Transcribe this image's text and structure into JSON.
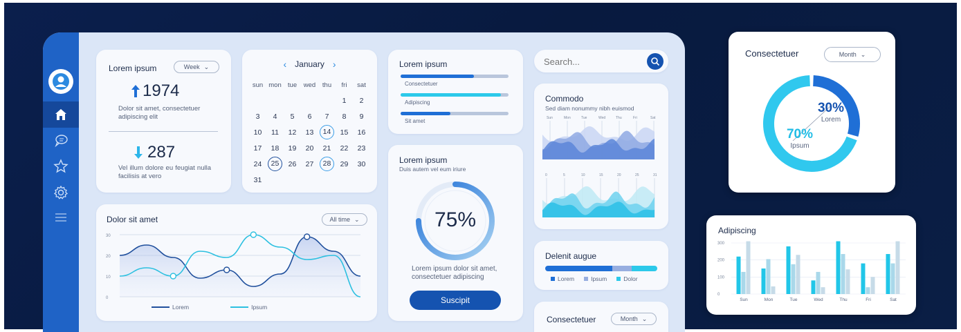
{
  "card1": {
    "title": "Lorem ipsum",
    "period": "Week",
    "stat1": "1974",
    "desc1": "Dolor sit amet, consectetuer adipiscing elit",
    "stat2": "287",
    "desc2": "Vel illum dolore eu feugiat nulla facilisis at vero"
  },
  "calendar": {
    "month": "January",
    "weekdays": [
      "sun",
      "mon",
      "tue",
      "wed",
      "thu",
      "fri",
      "sat"
    ],
    "rows": [
      [
        "",
        "",
        "",
        "",
        "",
        "1",
        "2"
      ],
      [
        "3",
        "4",
        "5",
        "6",
        "7",
        "8",
        "9"
      ],
      [
        "10",
        "11",
        "12",
        "13",
        "14",
        "15",
        "16"
      ],
      [
        "17",
        "18",
        "19",
        "20",
        "21",
        "22",
        "23"
      ],
      [
        "24",
        "25",
        "26",
        "27",
        "28",
        "29",
        "30"
      ],
      [
        "31",
        "",
        "",
        "",
        "",
        "",
        ""
      ]
    ],
    "circled_dark": [
      "25"
    ],
    "circled_light": [
      "14",
      "28"
    ]
  },
  "progress_card": {
    "title": "Lorem ipsum",
    "bars": [
      {
        "label": "Consectetuer",
        "value": 0.68,
        "color": "#1f6fd6"
      },
      {
        "label": "Adipiscing",
        "value": 0.93,
        "color": "#2cc9ea"
      },
      {
        "label": "Sit amet",
        "value": 0.46,
        "color": "#1f6fd6"
      }
    ]
  },
  "search": {
    "placeholder": "Search..."
  },
  "commodo": {
    "title": "Commodo",
    "subtitle": "Sed diam nonummy nibh euismod",
    "days": [
      "Sun",
      "Mon",
      "Tue",
      "Wed",
      "Thu",
      "Fri",
      "Sat"
    ],
    "ticks": [
      "0",
      "5",
      "10",
      "15",
      "20",
      "25",
      "31"
    ]
  },
  "gauge": {
    "title": "Lorem ipsum",
    "subtitle": "Duis autem vel eum iriure",
    "value": "75%",
    "fraction": 0.75,
    "desc": "Lorem ipsum dolor sit amet, consectetuer adipiscing",
    "button": "Suscipit"
  },
  "line_chart": {
    "title": "Dolor sit amet",
    "period": "All time",
    "legend": [
      "Lorem",
      "Ipsum"
    ]
  },
  "delenit": {
    "title": "Delenit augue",
    "segments": [
      {
        "name": "Lorem",
        "value": 0.6,
        "color": "#1f6fd6"
      },
      {
        "name": "Ipsum",
        "value": 0.17,
        "color": "#97aee0"
      },
      {
        "name": "Dolor",
        "value": 0.23,
        "color": "#2cc9ea"
      }
    ]
  },
  "consect_small": {
    "title": "Consectetuer",
    "period": "Month"
  },
  "donut": {
    "title": "Consectetuer",
    "period": "Month",
    "pct1": "30%",
    "label1": "Lorem",
    "pct2": "70%",
    "label2": "Ipsum",
    "fraction": 0.3
  },
  "adipiscing": {
    "title": "Adipiscing"
  },
  "chart_data": [
    {
      "type": "line",
      "title": "Dolor sit amet",
      "categories": [],
      "ylim": [
        0,
        30
      ],
      "yticks": [
        "0",
        "10",
        "20",
        "30"
      ],
      "series": [
        {
          "name": "Lorem",
          "color": "#1f4f9c",
          "values": [
            20,
            25,
            19,
            9,
            13,
            5,
            11,
            29,
            22,
            10
          ]
        },
        {
          "name": "Ipsum",
          "color": "#2cc0e0",
          "values": [
            10,
            14,
            10,
            22,
            19,
            30,
            24,
            18,
            20,
            0
          ]
        }
      ]
    },
    {
      "type": "bar",
      "title": "Adipiscing",
      "categories": [
        "Sun",
        "Mon",
        "Tue",
        "Wed",
        "Thu",
        "Fri",
        "Sat"
      ],
      "ylim": [
        0,
        300
      ],
      "yticks": [
        "0",
        "100",
        "200",
        "300"
      ],
      "series": [
        {
          "color": "#21c6e8",
          "values": [
            220,
            150,
            280,
            80,
            310,
            180,
            235
          ]
        },
        {
          "color": "#a9d8ea",
          "values": [
            130,
            205,
            175,
            130,
            235,
            40,
            180
          ]
        },
        {
          "color": "#c6dbe8",
          "values": [
            310,
            45,
            230,
            40,
            145,
            100,
            310
          ]
        }
      ]
    },
    {
      "type": "pie",
      "title": "Consectetuer",
      "categories": [
        "Lorem",
        "Ipsum"
      ],
      "values": [
        30,
        70
      ]
    }
  ]
}
